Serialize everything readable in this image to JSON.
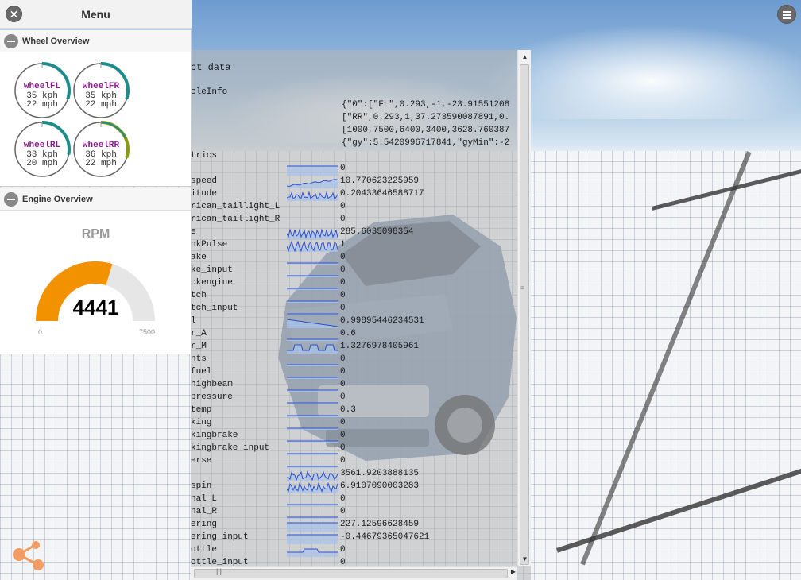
{
  "menu": {
    "title": "Menu",
    "close_icon": "close-icon"
  },
  "wheel_section": {
    "title": "Wheel Overview",
    "wheels": [
      {
        "name": "wheelFL",
        "kph": "35 kph",
        "mph": "22 mph",
        "level": 0.3
      },
      {
        "name": "wheelFR",
        "kph": "35 kph",
        "mph": "22 mph",
        "level": 0.3
      },
      {
        "name": "wheelRL",
        "kph": "33 kph",
        "mph": "20 mph",
        "level": 0.28
      },
      {
        "name": "wheelRR",
        "kph": "36 kph",
        "mph": "22 mph",
        "level": 0.3
      }
    ]
  },
  "engine_section": {
    "title": "Engine Overview",
    "label": "RPM",
    "value": "4441",
    "min": "0",
    "max": "7500",
    "level": 0.592,
    "colors": {
      "fill": "#f39200",
      "track": "#e6e6e6"
    }
  },
  "data_panel": {
    "header": "ct data",
    "vehicle_info_label": "cleInfo",
    "info_lines": [
      "{\"0\":[\"FL\",0.293,-1,-23.91551208",
      "[\"RR\",0.293,1,37.273590087891,0.",
      "[1000,7500,6400,3400,3628.760387",
      "{\"gy\":5.5420996717841,\"gyMin\":-2"
    ],
    "metrics_label": "trics",
    "rows": [
      {
        "name": "",
        "value": "0",
        "spark": "flat-top"
      },
      {
        "name": "speed",
        "value": "10.770623225959",
        "spark": "rise"
      },
      {
        "name": "itude",
        "value": "0.20433646588717",
        "spark": "noise"
      },
      {
        "name": "rican_taillight_L",
        "value": "0",
        "spark": "none"
      },
      {
        "name": "rican_taillight_R",
        "value": "0",
        "spark": "none"
      },
      {
        "name": "e",
        "value": "285.6035098354",
        "spark": "wave"
      },
      {
        "name": "nkPulse",
        "value": "1",
        "spark": "pulse"
      },
      {
        "name": "ake",
        "value": "0",
        "spark": "flat"
      },
      {
        "name": "ke_input",
        "value": "0",
        "spark": "flat"
      },
      {
        "name": "ckengine",
        "value": "0",
        "spark": "flat"
      },
      {
        "name": "tch",
        "value": "0",
        "spark": "flat"
      },
      {
        "name": "tch_input",
        "value": "0",
        "spark": "flat"
      },
      {
        "name": "l",
        "value": "0.99895446234531",
        "spark": "fall"
      },
      {
        "name": "r_A",
        "value": "0.6",
        "spark": "flat"
      },
      {
        "name": "r_M",
        "value": "1.3276978405961",
        "spark": "bumps"
      },
      {
        "name": "nts",
        "value": "0",
        "spark": "flat"
      },
      {
        "name": "fuel",
        "value": "0",
        "spark": "flat"
      },
      {
        "name": "highbeam",
        "value": "0",
        "spark": "flat"
      },
      {
        "name": "pressure",
        "value": "0",
        "spark": "flat"
      },
      {
        "name": "temp",
        "value": "0.3",
        "spark": "flat"
      },
      {
        "name": "king",
        "value": "0",
        "spark": "flat"
      },
      {
        "name": "kingbrake",
        "value": "0",
        "spark": "flat"
      },
      {
        "name": "kingbrake_input",
        "value": "0",
        "spark": "flat"
      },
      {
        "name": "erse",
        "value": "0",
        "spark": "flat"
      },
      {
        "name": "",
        "value": "3561.9203888135",
        "spark": "noise2"
      },
      {
        "name": "spin",
        "value": "6.9107090003283",
        "spark": "noise3"
      },
      {
        "name": "nal_L",
        "value": "0",
        "spark": "flat"
      },
      {
        "name": "nal_R",
        "value": "0",
        "spark": "flat"
      },
      {
        "name": "ering",
        "value": "227.12596628459",
        "spark": "block"
      },
      {
        "name": "ering_input",
        "value": "-0.44679365047621",
        "spark": "flat-top"
      },
      {
        "name": "ottle",
        "value": "0",
        "spark": "bump"
      },
      {
        "name": "ottle_input",
        "value": "0",
        "spark": "flat"
      }
    ]
  },
  "icons": {
    "menu": "hamburger-icon",
    "logo": "beamng-logo-icon"
  }
}
